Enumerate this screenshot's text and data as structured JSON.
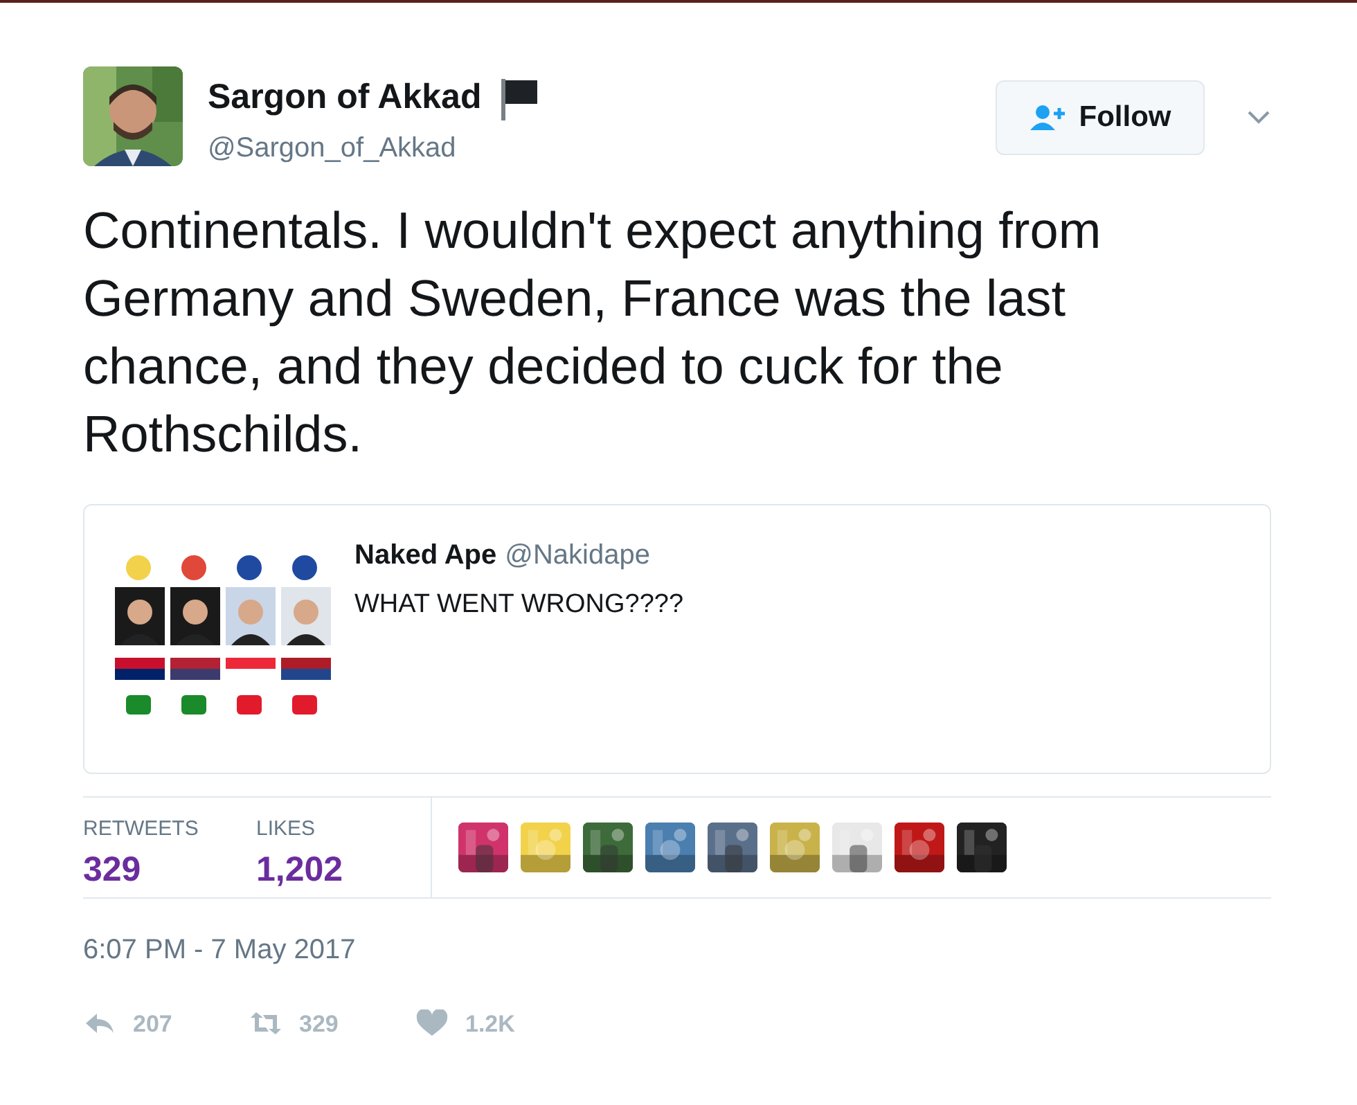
{
  "author": {
    "name": "Sargon of Akkad",
    "handle": "@Sargon_of_Akkad"
  },
  "follow_button": {
    "label": "Follow"
  },
  "text": "Continentals. I wouldn't expect anything from Germany and Sweden, France was the last chance, and they decided to cuck for the Rothschilds.",
  "quoted_tweet": {
    "name": "Naked Ape",
    "handle": "@Nakidape",
    "text": "WHAT WENT WRONG????"
  },
  "stats": [
    {
      "label": "RETWEETS",
      "value": "329"
    },
    {
      "label": "LIKES",
      "value": "1,202"
    }
  ],
  "likers": [
    {
      "color": "#d0336b"
    },
    {
      "color": "#f2d24b"
    },
    {
      "color": "#3d6b3a"
    },
    {
      "color": "#4a7fb0"
    },
    {
      "color": "#5a6f8a"
    },
    {
      "color": "#c9b24a"
    },
    {
      "color": "#e8e8e8"
    },
    {
      "color": "#c01818"
    },
    {
      "color": "#222222"
    }
  ],
  "timestamp": "6:07 PM - 7 May 2017",
  "actions": [
    {
      "kind": "reply",
      "count": "207"
    },
    {
      "kind": "retweet",
      "count": "329"
    },
    {
      "kind": "like",
      "count": "1.2K"
    }
  ]
}
